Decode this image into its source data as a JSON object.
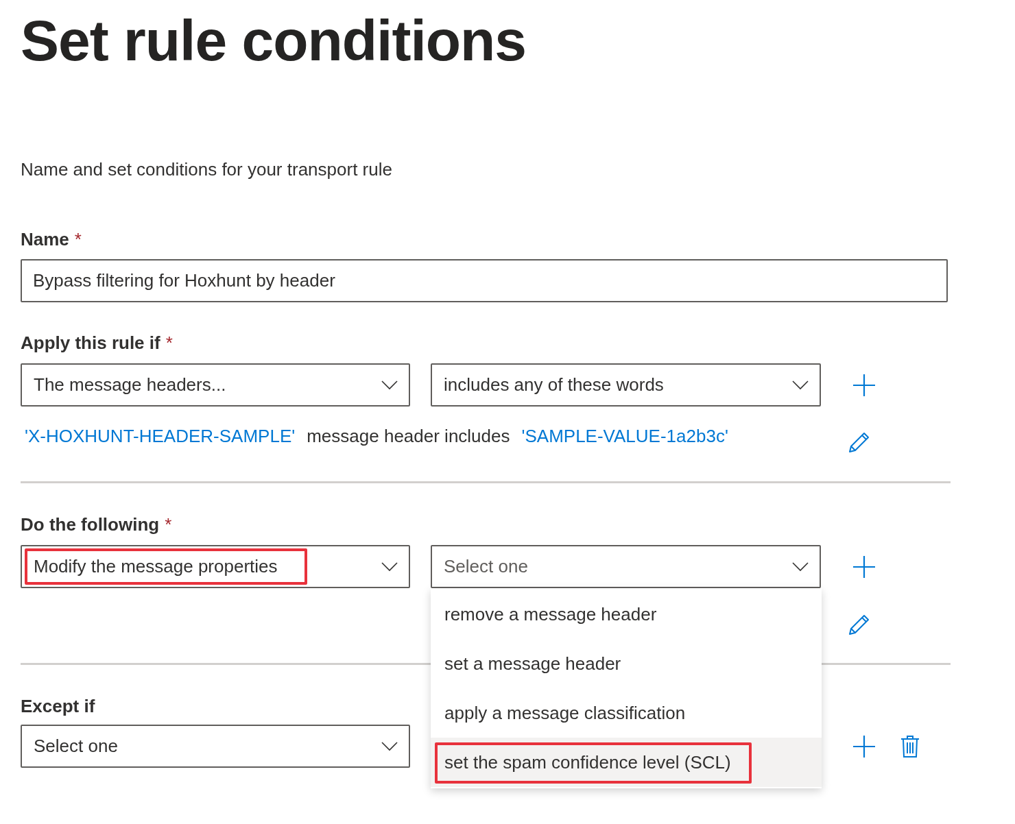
{
  "title": "Set rule conditions",
  "subtitle": "Name and set conditions for your transport rule",
  "name_field": {
    "label": "Name",
    "required_mark": "*",
    "value": "Bypass filtering for Hoxhunt by header"
  },
  "apply_rule": {
    "label": "Apply this rule if",
    "required_mark": "*",
    "dropdowns": [
      {
        "value": "The message headers...",
        "highlighted": false
      },
      {
        "value": "includes any of these words",
        "highlighted": false
      }
    ],
    "summary": [
      {
        "kind": "link",
        "text": "'X-HOXHUNT-HEADER-SAMPLE'"
      },
      {
        "kind": "plain",
        "text": "message header includes"
      },
      {
        "kind": "link",
        "text": "'SAMPLE-VALUE-1a2b3c'"
      }
    ]
  },
  "do_following": {
    "label": "Do the following",
    "required_mark": "*",
    "dropdowns": [
      {
        "value": "Modify the message properties",
        "highlighted": true
      },
      {
        "placeholder": "Select one",
        "highlighted": false,
        "expanded": true
      }
    ],
    "menu": [
      {
        "label": "remove a message header",
        "selected": false,
        "highlighted": false
      },
      {
        "label": "set a message header",
        "selected": false,
        "highlighted": false
      },
      {
        "label": "apply a message classification",
        "selected": false,
        "highlighted": false
      },
      {
        "label": "set the spam confidence level (SCL)",
        "selected": true,
        "highlighted": true
      }
    ]
  },
  "except_if": {
    "label": "Except if",
    "dropdowns": [
      {
        "value": "Select one",
        "highlighted": false
      }
    ]
  }
}
